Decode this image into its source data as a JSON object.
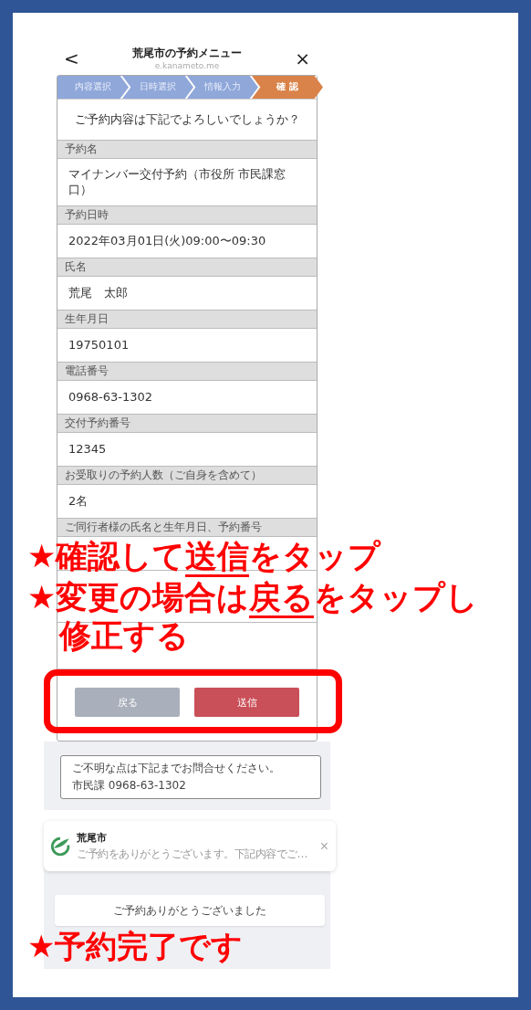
{
  "header": {
    "back": "<",
    "title": "荒尾市の予約メニュー",
    "subtitle": "e.kanameto.me",
    "close": "×"
  },
  "steps": [
    {
      "label": "内容選択",
      "selected": false
    },
    {
      "label": "日時選択",
      "selected": false
    },
    {
      "label": "情報入力",
      "selected": false
    },
    {
      "label": "確 認",
      "selected": true
    }
  ],
  "question": "ご予約内容は下記でよろしいでしょうか？",
  "fields": [
    {
      "label": "予約名",
      "value": "マイナンバー交付予約（市役所 市民課窓口）"
    },
    {
      "label": "予約日時",
      "value": "2022年03月01日(火)09:00〜09:30"
    },
    {
      "label": "氏名",
      "value": "荒尾　太郎"
    },
    {
      "label": "生年月日",
      "value": "19750101"
    },
    {
      "label": "電話番号",
      "value": "0968-63-1302"
    },
    {
      "label": "交付予約番号",
      "value": "12345"
    },
    {
      "label": "お受取りの予約人数（ご自身を含めて）",
      "value": "2名"
    },
    {
      "label": "ご同行者様の氏名と生年月日、予約番号"
    }
  ],
  "buttons": [
    {
      "label": "戻る",
      "kind": "back"
    },
    {
      "label": "送信",
      "kind": "submit"
    }
  ],
  "contact": {
    "lines": [
      "ご不明な点は下記までお問合せください。",
      "市民課 0968-63-1302"
    ]
  },
  "notification": {
    "title": "荒尾市",
    "message": "ご予約をありがとうございます。下記内容でご…",
    "close": "×"
  },
  "done_button": "ご予約ありがとうございました",
  "annotations": [
    {
      "parts": [
        {
          "text": "★確認して",
          "underline": false
        },
        {
          "text": "送信",
          "underline": true
        },
        {
          "text": "をタップ",
          "underline": false
        }
      ]
    },
    {
      "parts": [
        {
          "text": "★変更の場合は",
          "underline": false
        },
        {
          "text": "戻る",
          "underline": true
        },
        {
          "text": "をタップし修正する",
          "underline": false
        }
      ]
    }
  ],
  "done_note": "★予約完了です"
}
